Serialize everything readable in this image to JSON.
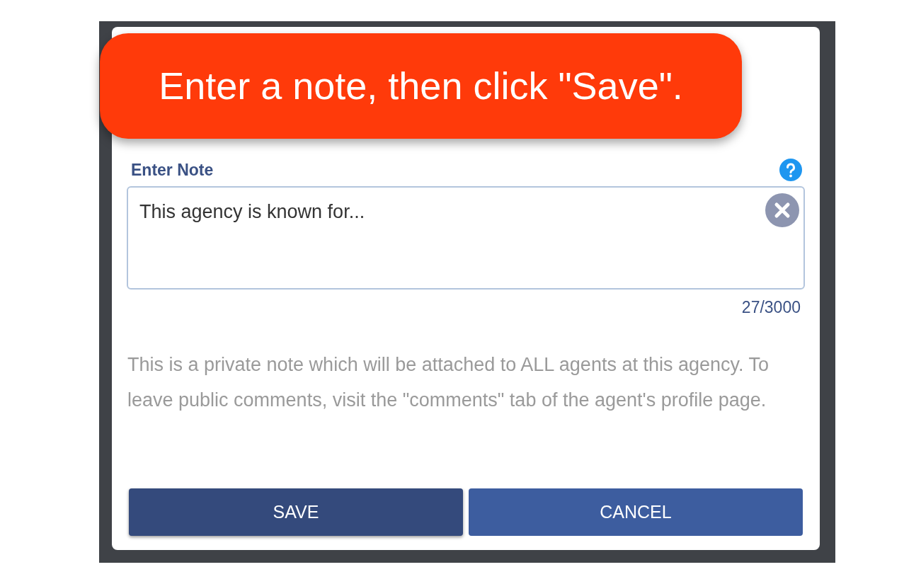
{
  "callout": {
    "text": "Enter a note, then click \"Save\"."
  },
  "note_field": {
    "label": "Enter Note",
    "value": "This agency is known for...",
    "counter": "27/3000"
  },
  "description": "This is a private note which will be attached to ALL agents at this agency. To leave public comments, visit the \"comments\" tab of the agent's profile page.",
  "buttons": [
    {
      "label": "SAVE",
      "kind": "primary"
    },
    {
      "label": "CANCEL",
      "kind": "secondary"
    }
  ]
}
